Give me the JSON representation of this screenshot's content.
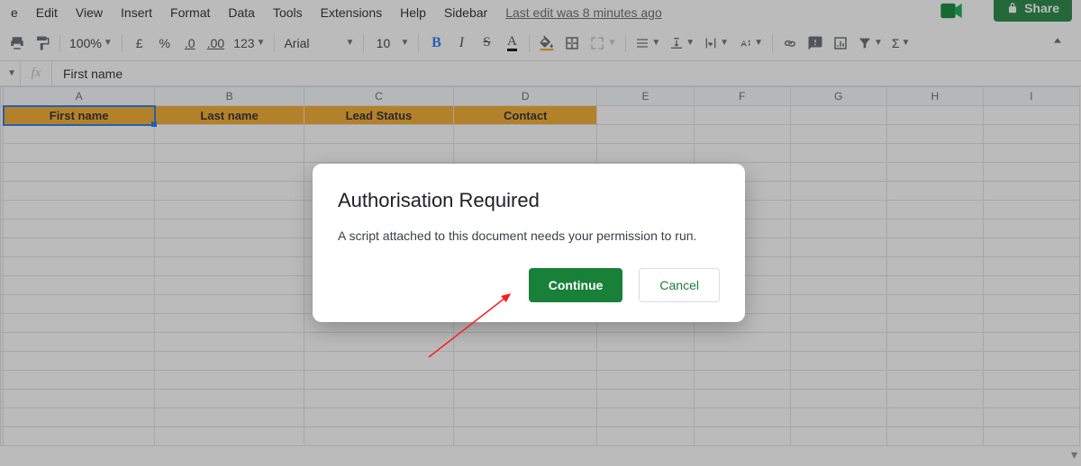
{
  "menus": [
    "e",
    "Edit",
    "View",
    "Insert",
    "Format",
    "Data",
    "Tools",
    "Extensions",
    "Help",
    "Sidebar"
  ],
  "last_edit": "Last edit was 8 minutes ago",
  "share_btn": "Share",
  "toolbar": {
    "zoom": "100%",
    "currency": "£",
    "percent": "%",
    "dec_less": ".0",
    "dec_more": ".00",
    "num_format": "123",
    "font": "Arial",
    "font_size": "10",
    "sigma": "Σ"
  },
  "fx": {
    "label": "fx",
    "value": "First name"
  },
  "columns": [
    "A",
    "B",
    "C",
    "D",
    "E",
    "F",
    "G",
    "H",
    "I"
  ],
  "header_row": [
    "First name",
    "Last name",
    "Lead Status",
    "Contact"
  ],
  "blank_rows": 17,
  "dialog": {
    "title": "Authorisation Required",
    "body": "A script attached to this document needs your permission to run.",
    "continue": "Continue",
    "cancel": "Cancel"
  }
}
